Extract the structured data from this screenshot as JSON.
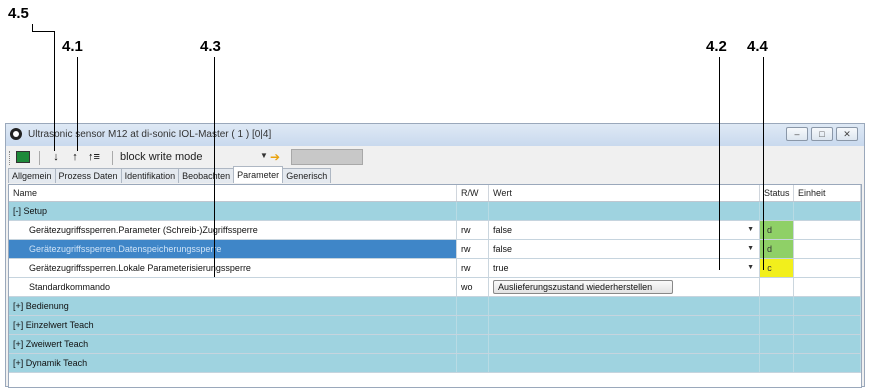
{
  "callouts": {
    "c45": "4.5",
    "c41": "4.1",
    "c43": "4.3",
    "c42": "4.2",
    "c44": "4.4"
  },
  "window": {
    "title": "Ultrasonic sensor M12 at di-sonic IOL-Master ( 1 ) [0|4]",
    "controls": [
      "minimize",
      "maximize",
      "close"
    ]
  },
  "toolbar": {
    "mode_label": "block write mode",
    "icons": [
      "monitor-icon",
      "arrow-down-icon",
      "arrow-up-icon",
      "arrow-up-all-icon",
      "apply-icon"
    ]
  },
  "tabs": [
    "Allgemein",
    "Prozess Daten",
    "Identifikation",
    "Beobachten",
    "Parameter",
    "Generisch"
  ],
  "active_tab": "Parameter",
  "table": {
    "headers": {
      "name": "Name",
      "rw": "R/W",
      "value": "Wert",
      "status": "Status",
      "unit": "Einheit"
    },
    "rows": [
      {
        "kind": "group",
        "name": "[-] Setup"
      },
      {
        "kind": "param",
        "name": "Gerätezugriffssperren.Parameter (Schreib-)Zugriffssperre",
        "rw": "rw",
        "value": "false",
        "dropdown": true,
        "status": "d",
        "status_color": "#8fd067"
      },
      {
        "kind": "param",
        "selected": true,
        "name": "Gerätezugriffssperren.Datenspeicherungssperre",
        "rw": "rw",
        "value": "false",
        "dropdown": true,
        "status": "d",
        "status_color": "#8fd067"
      },
      {
        "kind": "param",
        "name": "Gerätezugriffssperren.Lokale Parameterisierungssperre",
        "rw": "rw",
        "value": "true",
        "dropdown": true,
        "status": "c",
        "status_color": "#f2ef1c"
      },
      {
        "kind": "param",
        "name": "Standardkommando",
        "rw": "wo",
        "button": "Auslieferungszustand wiederherstellen"
      },
      {
        "kind": "group",
        "name": "[+] Bedienung"
      },
      {
        "kind": "group",
        "name": "[+] Einzelwert Teach"
      },
      {
        "kind": "group",
        "name": "[+] Zweiwert Teach"
      },
      {
        "kind": "group",
        "name": "[+] Dynamik Teach"
      }
    ]
  }
}
